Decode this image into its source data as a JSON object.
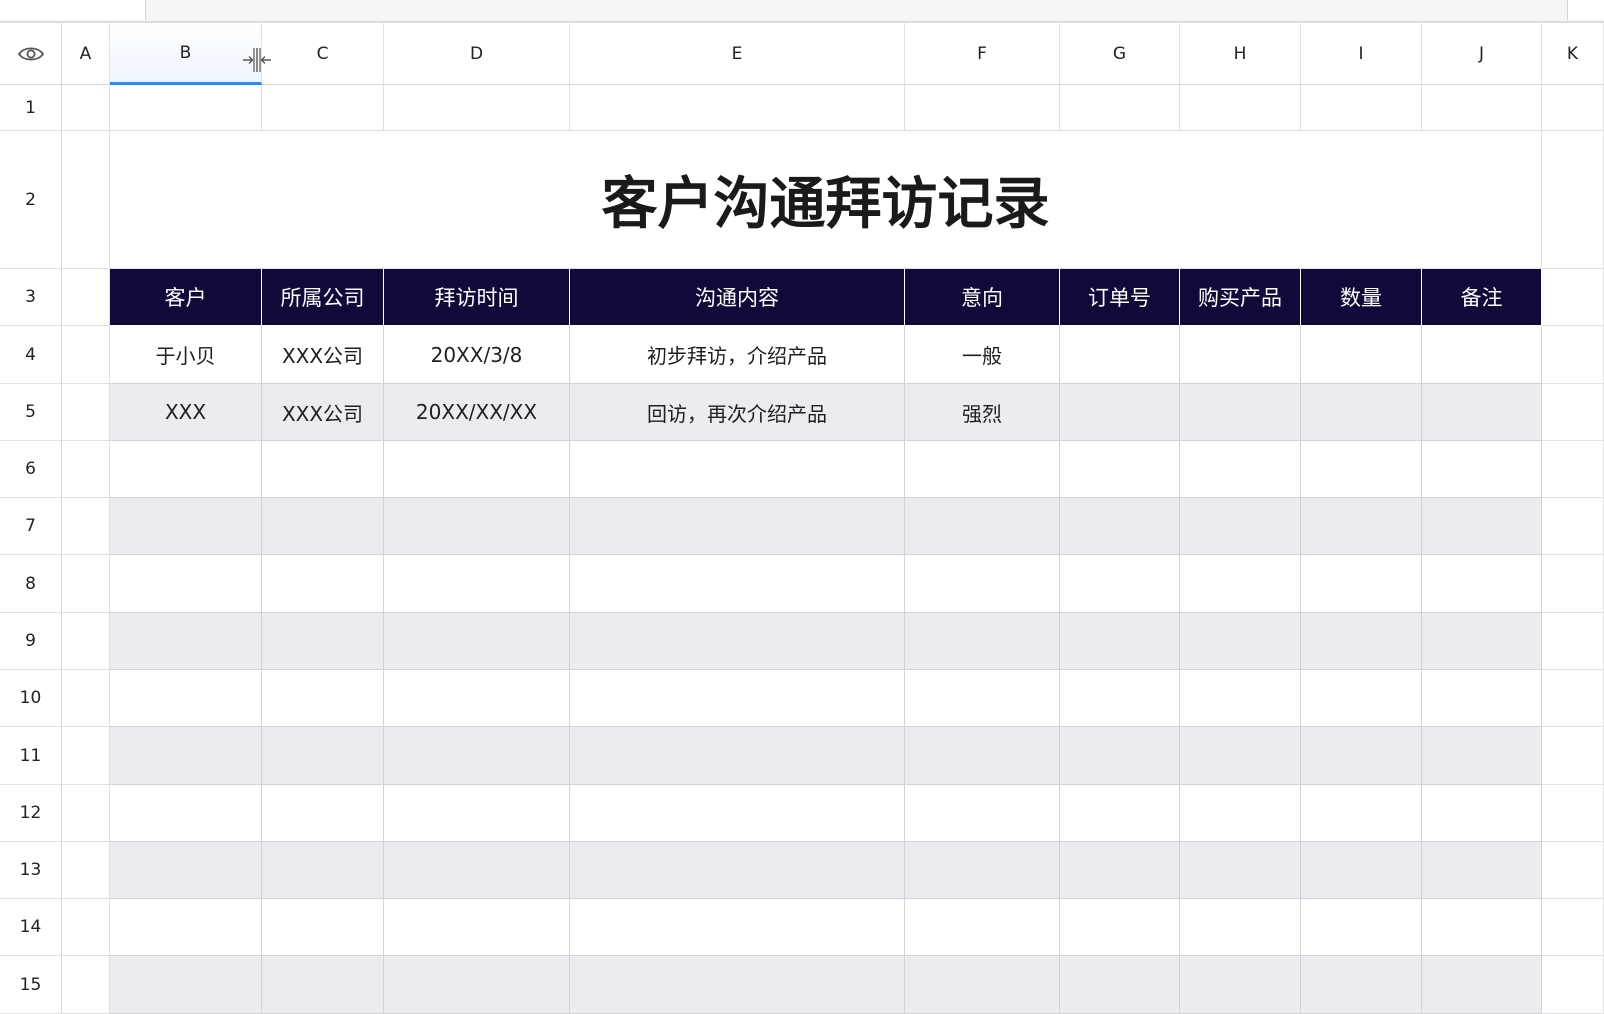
{
  "columns": [
    "A",
    "B",
    "C",
    "D",
    "E",
    "F",
    "G",
    "H",
    "I",
    "J",
    "K"
  ],
  "selected_column": "B",
  "rows": [
    "1",
    "2",
    "3",
    "4",
    "5",
    "6",
    "7",
    "8",
    "9",
    "10",
    "11",
    "12",
    "13",
    "14",
    "15"
  ],
  "sheet": {
    "title": "客户沟通拜访记录",
    "headers": [
      "客户",
      "所属公司",
      "拜访时间",
      "沟通内容",
      "意向",
      "订单号",
      "购买产品",
      "数量",
      "备注"
    ],
    "records": [
      [
        "于小贝",
        "XXX公司",
        "20XX/3/8",
        "初步拜访，介绍产品",
        "一般",
        "",
        "",
        "",
        ""
      ],
      [
        "XXX",
        "XXX公司",
        "20XX/XX/XX",
        "回访，再次介绍产品",
        "强烈",
        "",
        "",
        "",
        ""
      ]
    ],
    "empty_rows": 10
  },
  "colors": {
    "header_bg": "#12093a",
    "alt_row_bg": "#ebebf0",
    "selection_accent": "#2d8cf0"
  },
  "icons": {
    "visibility": "eye-icon",
    "column_resize": "column-resize-icon"
  }
}
